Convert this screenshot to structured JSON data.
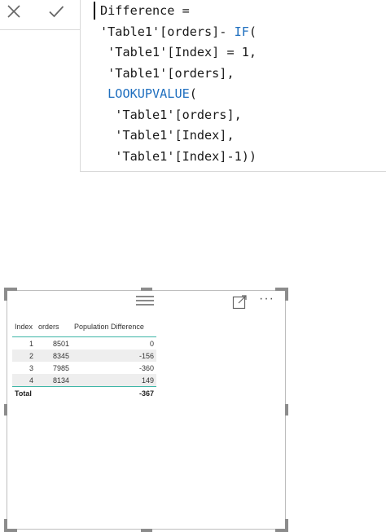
{
  "formula_bar": {
    "cancel_icon": "close-x-icon",
    "commit_icon": "checkmark-icon",
    "keyword_color": "#1f6fbf",
    "lines": [
      {
        "indent": 0,
        "parts": [
          {
            "t": "Difference =",
            "kw": false
          }
        ]
      },
      {
        "indent": 0,
        "parts": [
          {
            "t": "'Table1'[orders]- ",
            "kw": false
          },
          {
            "t": "IF",
            "kw": true
          },
          {
            "t": "(",
            "kw": false
          }
        ]
      },
      {
        "indent": 1,
        "parts": [
          {
            "t": "'Table1'[Index] = 1,",
            "kw": false
          }
        ]
      },
      {
        "indent": 1,
        "parts": [
          {
            "t": "'Table1'[orders],",
            "kw": false
          }
        ]
      },
      {
        "indent": 1,
        "parts": [
          {
            "t": "LOOKUPVALUE",
            "kw": true
          },
          {
            "t": "(",
            "kw": false
          }
        ]
      },
      {
        "indent": 2,
        "parts": [
          {
            "t": "'Table1'[orders],",
            "kw": false
          }
        ]
      },
      {
        "indent": 2,
        "parts": [
          {
            "t": "'Table1'[Index],",
            "kw": false
          }
        ]
      },
      {
        "indent": 2,
        "parts": [
          {
            "t": "'Table1'[Index]-1))",
            "kw": false
          }
        ]
      }
    ]
  },
  "visual": {
    "focus_icon": "focus-mode-icon",
    "more_icon": "more-options-icon",
    "more_label": "···",
    "accent_color": "#3cb5a6",
    "table": {
      "columns": [
        "Index",
        "orders",
        "Population Difference"
      ],
      "rows": [
        [
          "1",
          "8501",
          "0"
        ],
        [
          "2",
          "8345",
          "-156"
        ],
        [
          "3",
          "7985",
          "-360"
        ],
        [
          "4",
          "8134",
          "149"
        ]
      ],
      "total": {
        "label": "Total",
        "orders": "",
        "difference": "-367"
      }
    }
  }
}
